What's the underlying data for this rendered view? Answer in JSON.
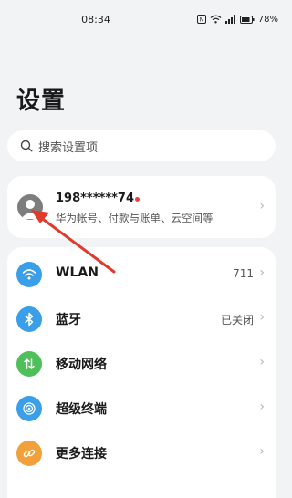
{
  "status_bar": {
    "time": "08:34",
    "battery": "78%",
    "icons": [
      "nfc-icon",
      "wifi-icon",
      "signal-icon",
      "battery-icon"
    ]
  },
  "page": {
    "title": "设置"
  },
  "search": {
    "placeholder": "搜索设置项",
    "icon": "search-icon"
  },
  "account": {
    "number": "198******74",
    "subtitle": "华为帐号、付款与账单、云空间等",
    "avatar_icon": "avatar-icon",
    "dot_color": "#e84040"
  },
  "settings": [
    {
      "label": "WLAN",
      "value": "711",
      "icon": "wifi-icon",
      "color": "#3a9ee8"
    },
    {
      "label": "蓝牙",
      "value": "已关闭",
      "icon": "bluetooth-icon",
      "color": "#3a9ee8"
    },
    {
      "label": "移动网络",
      "value": "",
      "icon": "mobile-network-icon",
      "color": "#4fbf5a"
    },
    {
      "label": "超级终端",
      "value": "",
      "icon": "super-device-icon",
      "color": "#3a9ee8"
    },
    {
      "label": "更多连接",
      "value": "",
      "icon": "link-icon",
      "color": "#f1a03a"
    }
  ],
  "annotation": {
    "arrow_color": "#e13a2d"
  }
}
